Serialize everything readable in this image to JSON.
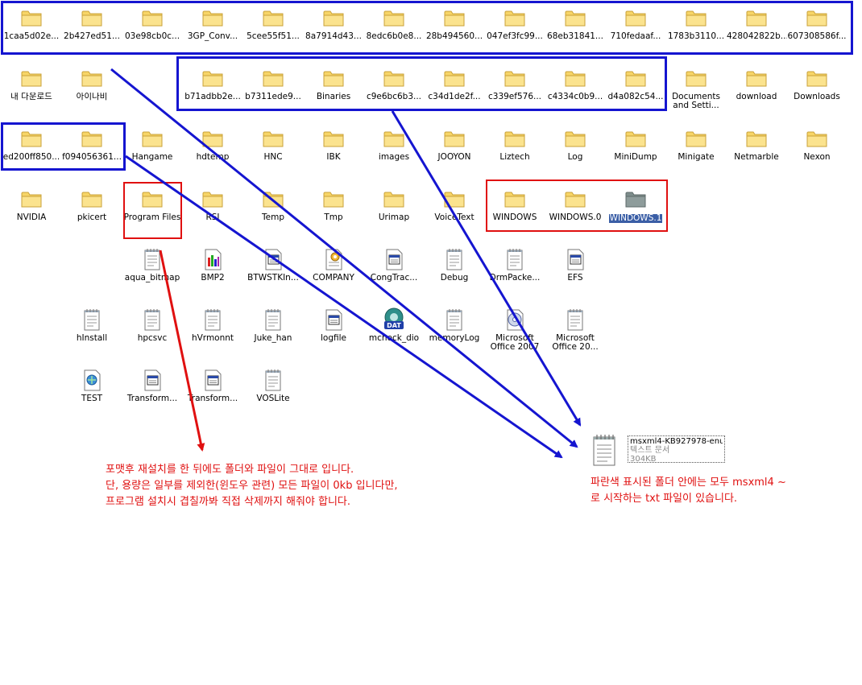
{
  "rows": [
    [
      {
        "label": "1caa5d02e...",
        "icon": "folder"
      },
      {
        "label": "2b427ed51...",
        "icon": "folder"
      },
      {
        "label": "03e98cb0c...",
        "icon": "folder"
      },
      {
        "label": "3GP_Conv...",
        "icon": "folder"
      },
      {
        "label": "5cee55f51...",
        "icon": "folder"
      },
      {
        "label": "8a7914d43...",
        "icon": "folder"
      },
      {
        "label": "8edc6b0e8...",
        "icon": "folder"
      },
      {
        "label": "28b494560...",
        "icon": "folder"
      },
      {
        "label": "047ef3fc99...",
        "icon": "folder"
      },
      {
        "label": "68eb31841...",
        "icon": "folder"
      },
      {
        "label": "710fedaaf...",
        "icon": "folder"
      },
      {
        "label": "1783b3110...",
        "icon": "folder"
      },
      {
        "label": "428042822b...",
        "icon": "folder"
      },
      {
        "label": "607308586f...",
        "icon": "folder"
      }
    ],
    [
      {
        "label": "내 다운로드",
        "icon": "folder"
      },
      {
        "label": "아이나비",
        "icon": "folder"
      },
      {
        "label": "",
        "icon": "none"
      },
      {
        "label": "b71adbb2e...",
        "icon": "folder"
      },
      {
        "label": "b7311ede9...",
        "icon": "folder"
      },
      {
        "label": "Binaries",
        "icon": "folder"
      },
      {
        "label": "c9e6bc6b3...",
        "icon": "folder"
      },
      {
        "label": "c34d1de2f...",
        "icon": "folder"
      },
      {
        "label": "c339ef576...",
        "icon": "folder"
      },
      {
        "label": "c4334c0b9...",
        "icon": "folder"
      },
      {
        "label": "d4a082c54...",
        "icon": "folder"
      },
      {
        "label": "Documents and Setti...",
        "icon": "folder",
        "two": true
      },
      {
        "label": "download",
        "icon": "folder"
      },
      {
        "label": "Downloads",
        "icon": "folder"
      }
    ],
    [
      {
        "label": "ed200ff850...",
        "icon": "folder"
      },
      {
        "label": "f094056361...",
        "icon": "folder"
      },
      {
        "label": "Hangame",
        "icon": "folder"
      },
      {
        "label": "hdtemp",
        "icon": "folder"
      },
      {
        "label": "HNC",
        "icon": "folder"
      },
      {
        "label": "IBK",
        "icon": "folder"
      },
      {
        "label": "images",
        "icon": "folder"
      },
      {
        "label": "JOOYON",
        "icon": "folder"
      },
      {
        "label": "Liztech",
        "icon": "folder"
      },
      {
        "label": "Log",
        "icon": "folder"
      },
      {
        "label": "MiniDump",
        "icon": "folder"
      },
      {
        "label": "Minigate",
        "icon": "folder"
      },
      {
        "label": "Netmarble",
        "icon": "folder"
      },
      {
        "label": "Nexon",
        "icon": "folder"
      }
    ],
    [
      {
        "label": "NVIDIA",
        "icon": "folder"
      },
      {
        "label": "pkicert",
        "icon": "folder"
      },
      {
        "label": "Program Files",
        "icon": "folder",
        "two": true
      },
      {
        "label": "RSI",
        "icon": "folder"
      },
      {
        "label": "Temp",
        "icon": "folder"
      },
      {
        "label": "Tmp",
        "icon": "folder"
      },
      {
        "label": "Urimap",
        "icon": "folder"
      },
      {
        "label": "VoiceText",
        "icon": "folder"
      },
      {
        "label": "WINDOWS",
        "icon": "folder"
      },
      {
        "label": "WINDOWS.0",
        "icon": "folder"
      },
      {
        "label": "WINDOWS.1",
        "icon": "folder-selected",
        "selected": true
      }
    ],
    [
      {
        "label": "",
        "icon": "none"
      },
      {
        "label": "",
        "icon": "none"
      },
      {
        "label": "aqua_bitmap",
        "icon": "notepad"
      },
      {
        "label": "BMP2",
        "icon": "bitmap"
      },
      {
        "label": "BTWSTKIn...",
        "icon": "window-file"
      },
      {
        "label": "COMPANY",
        "icon": "config"
      },
      {
        "label": "CongTrac...",
        "icon": "window-file"
      },
      {
        "label": "Debug",
        "icon": "notepad"
      },
      {
        "label": "DrmPacke...",
        "icon": "notepad"
      },
      {
        "label": "EFS",
        "icon": "window-file"
      }
    ],
    [
      {
        "label": "",
        "icon": "none"
      },
      {
        "label": "hInstall",
        "icon": "notepad"
      },
      {
        "label": "hpcsvc",
        "icon": "notepad"
      },
      {
        "label": "hVrmonnt",
        "icon": "notepad"
      },
      {
        "label": "Juke_han",
        "icon": "notepad"
      },
      {
        "label": "logfile",
        "icon": "window-file"
      },
      {
        "label": "mcheck_dio",
        "icon": "dat"
      },
      {
        "label": "memoryLog",
        "icon": "notepad"
      },
      {
        "label": "Microsoft Office 2007",
        "icon": "office",
        "two": true
      },
      {
        "label": "Microsoft Office 20...",
        "icon": "notepad",
        "two": true
      }
    ],
    [
      {
        "label": "",
        "icon": "none"
      },
      {
        "label": "TEST",
        "icon": "xml"
      },
      {
        "label": "Transform...",
        "icon": "window-file"
      },
      {
        "label": "Transform...",
        "icon": "window-file"
      },
      {
        "label": "VOSLite",
        "icon": "notepad"
      }
    ]
  ],
  "target_file": {
    "name": "msxml4-KB927978-enu",
    "type": "텍스트 문서",
    "size": "304KB",
    "icon": "notepad"
  },
  "notes": {
    "red": [
      "포맷후 재설치를 한 뒤에도 폴더와 파일이 그대로 입니다.",
      "단, 용량은 일부를 제외한(윈도우 관련) 모든 파일이 0kb 입니다만,",
      "프로그램 설치시 겹칠까봐 직접 삭제까지 해줘야 합니다."
    ],
    "blue_explain": [
      "파란색 표시된 폴더 안에는 모두 msxml4 ~",
      "로 시작하는 txt 파일이 있습니다."
    ]
  },
  "colors": {
    "annotation_blue": "#1515d0",
    "annotation_red": "#e01010",
    "selection": "#3a5ea6",
    "folder_fill": "#f7d567",
    "folder_edge": "#c9a13a"
  }
}
